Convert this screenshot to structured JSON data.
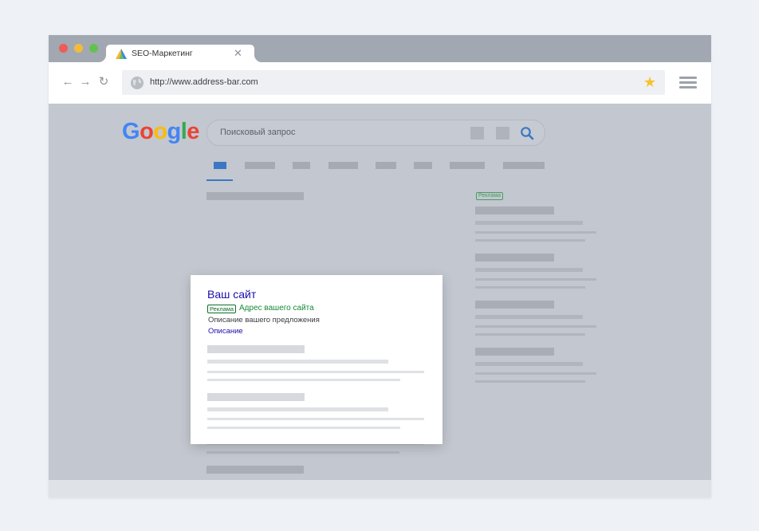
{
  "tab": {
    "title": "SEO-Маркетинг",
    "close_glyph": "✕"
  },
  "nav": {
    "back_glyph": "←",
    "forward_glyph": "→",
    "reload_glyph": "↻"
  },
  "address_bar": {
    "url": "http://www.address-bar.com"
  },
  "star_glyph": "★",
  "google": {
    "logo_letters": [
      {
        "ch": "G",
        "color": "#4285f4"
      },
      {
        "ch": "o",
        "color": "#ea4335"
      },
      {
        "ch": "o",
        "color": "#fbbc05"
      },
      {
        "ch": "g",
        "color": "#4285f4"
      },
      {
        "ch": "l",
        "color": "#34a853"
      },
      {
        "ch": "e",
        "color": "#ea4335"
      }
    ],
    "search_placeholder": "Поисковый запрос"
  },
  "ad_card": {
    "title": "Ваш сайт",
    "ad_label": "Реклама",
    "url_text": "Адрес вашего сайта",
    "description": "Описание вашего предложения",
    "link_text": "Описание"
  },
  "side_ad_label": "Реклама",
  "colors": {
    "accent_blue": "#3b78c4",
    "ad_green": "#1e8e3e",
    "link_blue": "#1a0dab",
    "star_yellow": "#f6c22b"
  }
}
